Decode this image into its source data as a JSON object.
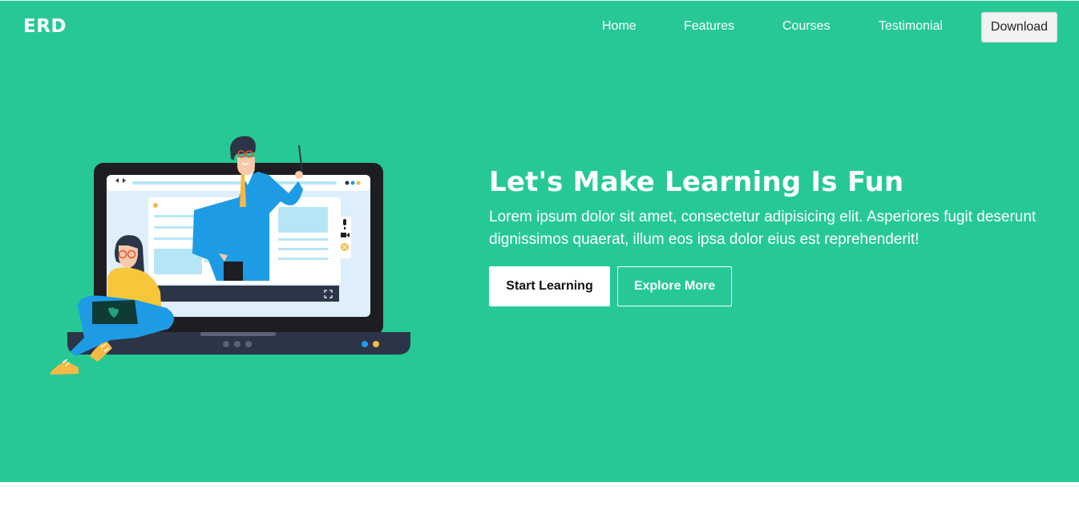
{
  "brand": {
    "logo": "ERD"
  },
  "nav": {
    "items": [
      {
        "label": "Home"
      },
      {
        "label": "Features"
      },
      {
        "label": "Courses"
      },
      {
        "label": "Testimonial"
      }
    ],
    "download_label": "Download"
  },
  "hero": {
    "title": "Let's Make Learning Is Fun",
    "text": "Lorem ipsum dolor sit amet, consectetur adipisicing elit. Asperiores fugit deserunt dignissimos quaerat, illum eos ipsa dolor eius est reprehenderit!",
    "primary_button": "Start Learning",
    "secondary_button": "Explore More"
  },
  "colors": {
    "hero_background": "#26c995",
    "laptop_body": "#1e1e22",
    "laptop_base": "#2c3448",
    "screen": "#dfeefb",
    "accent_blue": "#1ea0e6",
    "accent_yellow": "#f7b945"
  },
  "icons": [
    "play-pause-icon",
    "fullscreen-icon",
    "microphone-icon",
    "video-camera-icon",
    "close-circle-icon",
    "heart-icon"
  ]
}
